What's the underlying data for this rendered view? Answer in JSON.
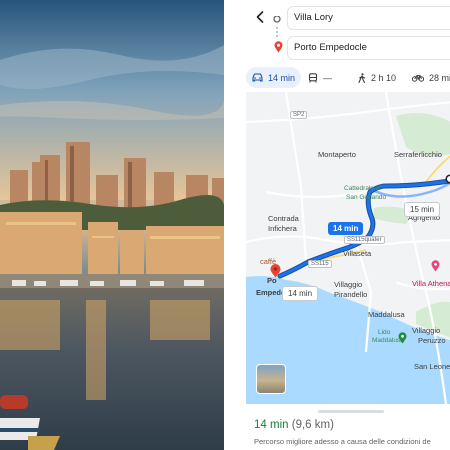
{
  "left_photo": {
    "subject": "harbor-town-photo"
  },
  "directions": {
    "origin": "Villa Lory",
    "destination": "Porto Empedocle"
  },
  "modes": [
    {
      "icon": "car-icon",
      "label": "14 min",
      "active": true
    },
    {
      "icon": "transit-icon",
      "label": "—",
      "active": false
    },
    {
      "icon": "walk-icon",
      "label": "2 h 10",
      "active": false
    },
    {
      "icon": "bike-icon",
      "label": "28 min",
      "active": false
    }
  ],
  "map": {
    "places": {
      "montaperto": "Montaperto",
      "serraferlicchio": "Serraferlicchio",
      "cattedrale": "Cattedrale di",
      "san_gerlando": "San Gerlando",
      "agrigento": "Agrigento",
      "contrada": "Contrada",
      "infichera": "Infichera",
      "villaseta": "Villaseta",
      "villaggio_pirandello_1": "Villaggio",
      "villaggio_pirandello_2": "Pirandello",
      "maddalusa": "Maddalusa",
      "lido_1": "Lido",
      "lido_2": "Maddalusa",
      "villaggio_peruzzo_1": "Villaggio",
      "villaggio_peruzzo_2": "Peruzzo",
      "san_leone": "San Leone",
      "villa_athena": "Villa Athena Resort",
      "caffe": "caffè",
      "porto_short": "Po",
      "empedocle_short": "Empedo"
    },
    "shields": {
      "sp2": "SP2",
      "ss115quater": "SS115quater",
      "ss115": "SS115"
    },
    "route_time_main": "14 min",
    "route_time_alt": "15 min",
    "route_time_bottom": "14 min"
  },
  "sheet": {
    "eta_time": "14 min",
    "eta_distance": "(9,6 km)",
    "subtitle": "Percorso migliore adesso a causa delle condizioni de"
  },
  "colors": {
    "route": "#1a73e8",
    "alt_route": "#8ab4f8",
    "sea": "#aadaff",
    "land": "#f1f3f4",
    "eta_green": "#188038"
  }
}
